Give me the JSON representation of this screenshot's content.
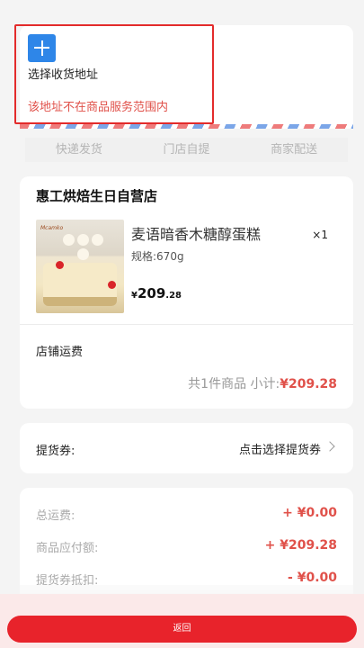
{
  "address": {
    "select_label": "选择收货地址",
    "warning": "该地址不在商品服务范围内"
  },
  "delivery_tabs": [
    "快递发货",
    "门店自提",
    "商家配送"
  ],
  "store": {
    "name": "惠工烘焙生日自营店",
    "product": {
      "title": "麦语暗香木糖醇蛋糕",
      "quantity": "×1",
      "spec": "规格:670g",
      "image_brand": "Mcamko",
      "price_currency": "¥",
      "price_int": "209",
      "price_dec": ".28"
    },
    "shipping_label": "店铺运费",
    "subtotal_text": "共1件商品 小计:",
    "subtotal_amount": "¥209.28"
  },
  "voucher": {
    "label": "提货券:",
    "action": "点击选择提货券"
  },
  "summary": [
    {
      "label": "总运费:",
      "value": "+ ¥0.00"
    },
    {
      "label": "商品应付额:",
      "value": "+ ¥209.28"
    },
    {
      "label": "提货券抵扣:",
      "value": "- ¥0.00"
    }
  ],
  "footer": {
    "return_label": "返回"
  },
  "colors": {
    "accent_red": "#e8232b",
    "warning_red": "#e0514a",
    "add_blue": "#2e86e8"
  }
}
